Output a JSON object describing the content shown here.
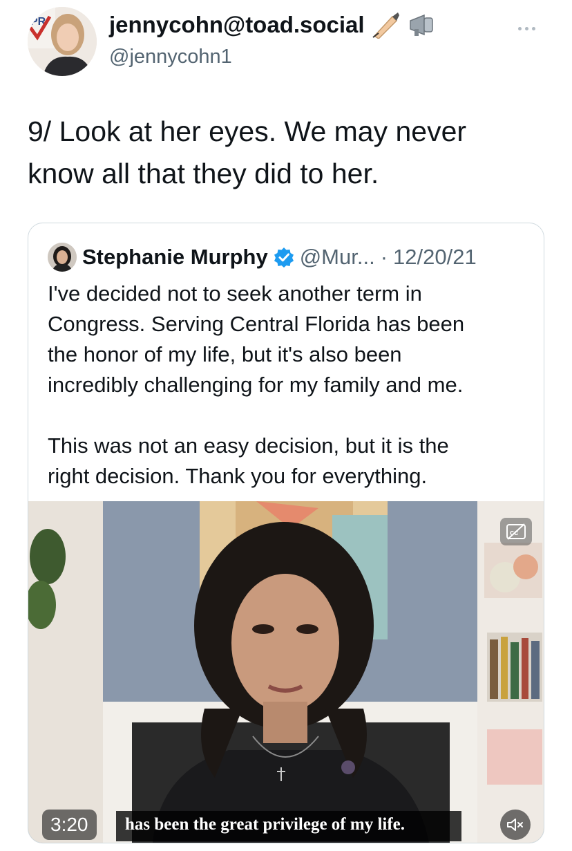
{
  "author": {
    "display_name": "jennycohn@toad.social",
    "emoji_1": "writing-hand-emoji",
    "emoji_2": "megaphone-emoji",
    "handle": "@jennycohn1",
    "avatar_badge_text": "PR"
  },
  "tweet": {
    "text": "9/ Look at her eyes. We may never\nknow all that they did to her."
  },
  "quoted_tweet": {
    "name": "Stephanie Murphy",
    "verified": true,
    "handle": "@Mur...",
    "separator": "·",
    "date": "12/20/21",
    "text": "I've decided not to seek another term in\nCongress. Serving Central Florida has been\nthe honor of my life, but it's also been\nincredibly challenging for my family and me.\n\nThis was not an easy decision, but it is the\nright decision. Thank you for everything.",
    "video": {
      "duration": "3:20",
      "caption": "has been the great privilege of my life."
    }
  },
  "colors": {
    "text_primary": "#0f1419",
    "text_secondary": "#536471",
    "verified_blue": "#1d9bf0",
    "card_border": "#cfd9de"
  }
}
